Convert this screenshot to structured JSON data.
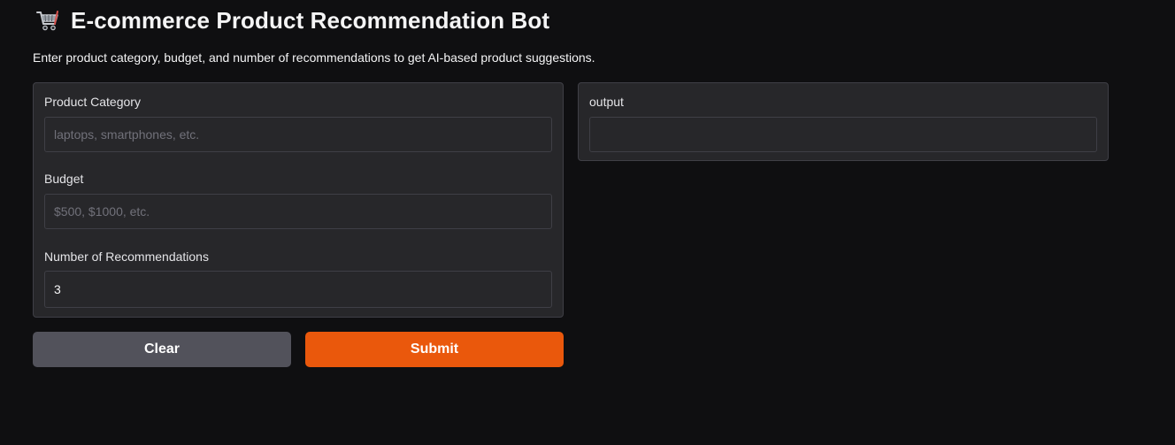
{
  "header": {
    "icon": "shopping-cart-icon",
    "title": "E-commerce Product Recommendation Bot"
  },
  "description": "Enter product category, budget, and number of recommendations to get AI-based product suggestions.",
  "inputs": {
    "category": {
      "label": "Product Category",
      "value": "",
      "placeholder": "laptops, smartphones, etc."
    },
    "budget": {
      "label": "Budget",
      "value": "",
      "placeholder": "$500, $1000, etc."
    },
    "num_recommendations": {
      "label": "Number of Recommendations",
      "value": "3",
      "placeholder": ""
    }
  },
  "output": {
    "label": "output",
    "value": ""
  },
  "buttons": {
    "clear_label": "Clear",
    "submit_label": "Submit"
  },
  "colors": {
    "background": "#0f0f11",
    "panel": "#27272a",
    "border": "#3f3f46",
    "clear_button": "#52525b",
    "submit_button": "#ea580c"
  }
}
